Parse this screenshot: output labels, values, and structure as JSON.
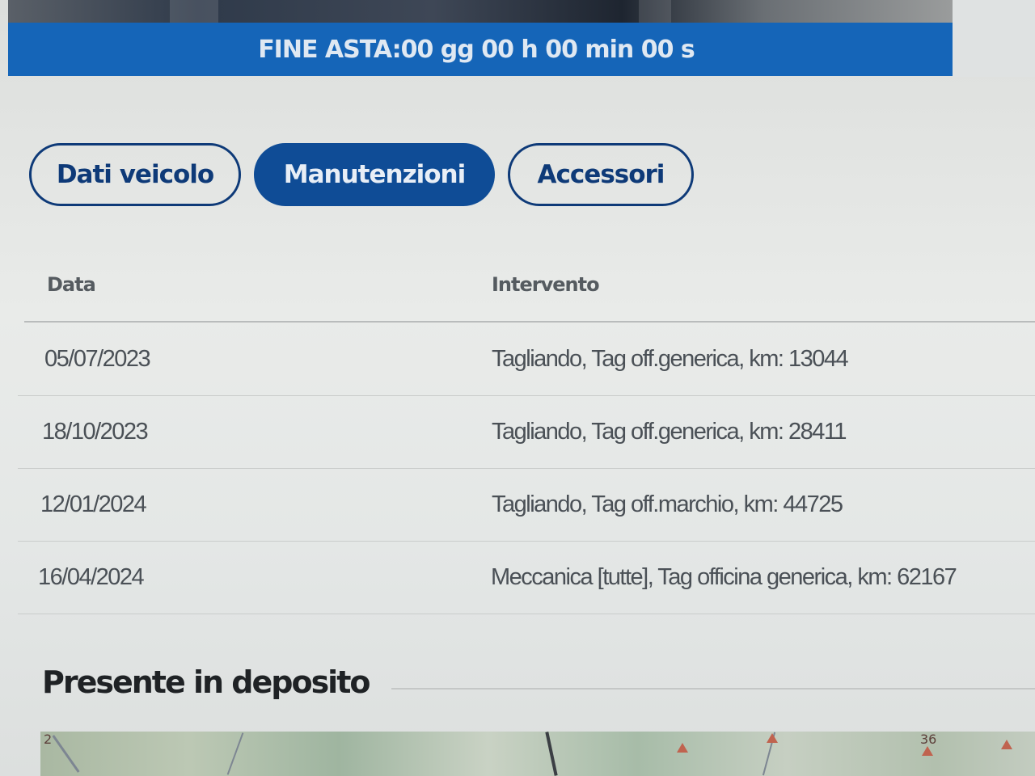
{
  "timer": {
    "text": "FINE ASTA:00 gg 00 h 00 min 00 s"
  },
  "tabs": [
    {
      "label": "Dati veicolo",
      "active": false
    },
    {
      "label": "Manutenzioni",
      "active": true
    },
    {
      "label": "Accessori",
      "active": false
    }
  ],
  "table": {
    "headers": [
      "Data",
      "Intervento"
    ],
    "rows": [
      {
        "date": "05/07/2023",
        "intervento": "Tagliando, Tag off.generica, km: 13044"
      },
      {
        "date": "18/10/2023",
        "intervento": "Tagliando, Tag off.generica, km: 28411"
      },
      {
        "date": "12/01/2024",
        "intervento": "Tagliando, Tag off.marchio, km: 44725"
      },
      {
        "date": "16/04/2024",
        "intervento": "Meccanica [tutte], Tag officina generica, km: 62167"
      }
    ]
  },
  "section": {
    "title": "Presente in deposito"
  },
  "map": {
    "label_left": "2",
    "label_right": "36"
  },
  "colors": {
    "timer_bar": "#1565b8",
    "tab_border": "#0e3a78",
    "tab_active": "#0f4c96"
  }
}
